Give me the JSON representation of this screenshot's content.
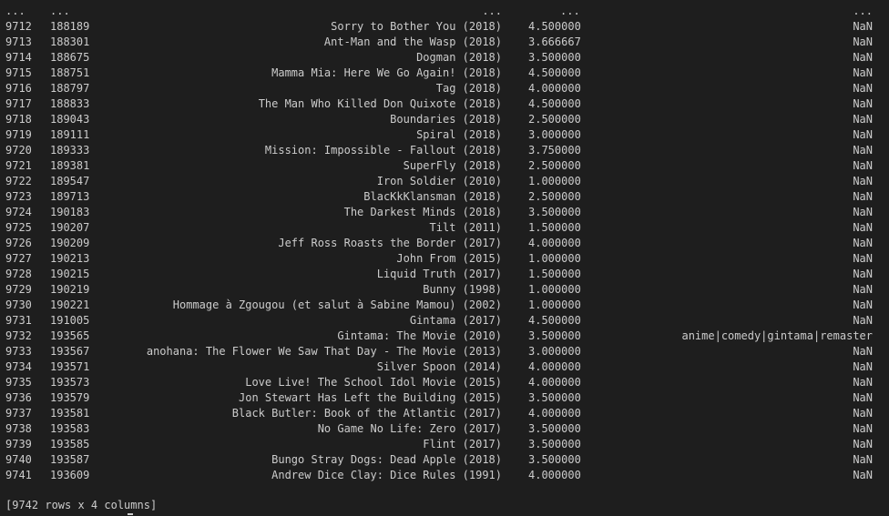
{
  "ellipsis_row": {
    "idx": "...",
    "movie_id": "...",
    "title": "...",
    "rating": "...",
    "tags": "..."
  },
  "rows": [
    {
      "idx": "9712",
      "movie_id": "188189",
      "title": "Sorry to Bother You (2018)",
      "rating": "4.500000",
      "tags": "NaN"
    },
    {
      "idx": "9713",
      "movie_id": "188301",
      "title": "Ant-Man and the Wasp (2018)",
      "rating": "3.666667",
      "tags": "NaN"
    },
    {
      "idx": "9714",
      "movie_id": "188675",
      "title": "Dogman (2018)",
      "rating": "3.500000",
      "tags": "NaN"
    },
    {
      "idx": "9715",
      "movie_id": "188751",
      "title": "Mamma Mia: Here We Go Again! (2018)",
      "rating": "4.500000",
      "tags": "NaN"
    },
    {
      "idx": "9716",
      "movie_id": "188797",
      "title": "Tag (2018)",
      "rating": "4.000000",
      "tags": "NaN"
    },
    {
      "idx": "9717",
      "movie_id": "188833",
      "title": "The Man Who Killed Don Quixote (2018)",
      "rating": "4.500000",
      "tags": "NaN"
    },
    {
      "idx": "9718",
      "movie_id": "189043",
      "title": "Boundaries (2018)",
      "rating": "2.500000",
      "tags": "NaN"
    },
    {
      "idx": "9719",
      "movie_id": "189111",
      "title": "Spiral (2018)",
      "rating": "3.000000",
      "tags": "NaN"
    },
    {
      "idx": "9720",
      "movie_id": "189333",
      "title": "Mission: Impossible - Fallout (2018)",
      "rating": "3.750000",
      "tags": "NaN"
    },
    {
      "idx": "9721",
      "movie_id": "189381",
      "title": "SuperFly (2018)",
      "rating": "2.500000",
      "tags": "NaN"
    },
    {
      "idx": "9722",
      "movie_id": "189547",
      "title": "Iron Soldier (2010)",
      "rating": "1.000000",
      "tags": "NaN"
    },
    {
      "idx": "9723",
      "movie_id": "189713",
      "title": "BlacKkKlansman (2018)",
      "rating": "2.500000",
      "tags": "NaN"
    },
    {
      "idx": "9724",
      "movie_id": "190183",
      "title": "The Darkest Minds (2018)",
      "rating": "3.500000",
      "tags": "NaN"
    },
    {
      "idx": "9725",
      "movie_id": "190207",
      "title": "Tilt (2011)",
      "rating": "1.500000",
      "tags": "NaN"
    },
    {
      "idx": "9726",
      "movie_id": "190209",
      "title": "Jeff Ross Roasts the Border (2017)",
      "rating": "4.000000",
      "tags": "NaN"
    },
    {
      "idx": "9727",
      "movie_id": "190213",
      "title": "John From (2015)",
      "rating": "1.000000",
      "tags": "NaN"
    },
    {
      "idx": "9728",
      "movie_id": "190215",
      "title": "Liquid Truth (2017)",
      "rating": "1.500000",
      "tags": "NaN"
    },
    {
      "idx": "9729",
      "movie_id": "190219",
      "title": "Bunny (1998)",
      "rating": "1.000000",
      "tags": "NaN"
    },
    {
      "idx": "9730",
      "movie_id": "190221",
      "title": "Hommage à Zgougou (et salut à Sabine Mamou) (2002)",
      "rating": "1.000000",
      "tags": "NaN"
    },
    {
      "idx": "9731",
      "movie_id": "191005",
      "title": "Gintama (2017)",
      "rating": "4.500000",
      "tags": "NaN"
    },
    {
      "idx": "9732",
      "movie_id": "193565",
      "title": "Gintama: The Movie (2010)",
      "rating": "3.500000",
      "tags": "anime|comedy|gintama|remaster"
    },
    {
      "idx": "9733",
      "movie_id": "193567",
      "title": "anohana: The Flower We Saw That Day - The Movie (2013)",
      "rating": "3.000000",
      "tags": "NaN"
    },
    {
      "idx": "9734",
      "movie_id": "193571",
      "title": "Silver Spoon (2014)",
      "rating": "4.000000",
      "tags": "NaN"
    },
    {
      "idx": "9735",
      "movie_id": "193573",
      "title": "Love Live! The School Idol Movie (2015)",
      "rating": "4.000000",
      "tags": "NaN"
    },
    {
      "idx": "9736",
      "movie_id": "193579",
      "title": "Jon Stewart Has Left the Building (2015)",
      "rating": "3.500000",
      "tags": "NaN"
    },
    {
      "idx": "9737",
      "movie_id": "193581",
      "title": "Black Butler: Book of the Atlantic (2017)",
      "rating": "4.000000",
      "tags": "NaN"
    },
    {
      "idx": "9738",
      "movie_id": "193583",
      "title": "No Game No Life: Zero (2017)",
      "rating": "3.500000",
      "tags": "NaN"
    },
    {
      "idx": "9739",
      "movie_id": "193585",
      "title": "Flint (2017)",
      "rating": "3.500000",
      "tags": "NaN"
    },
    {
      "idx": "9740",
      "movie_id": "193587",
      "title": "Bungo Stray Dogs: Dead Apple (2018)",
      "rating": "3.500000",
      "tags": "NaN"
    },
    {
      "idx": "9741",
      "movie_id": "193609",
      "title": "Andrew Dice Clay: Dice Rules (1991)",
      "rating": "4.000000",
      "tags": "NaN"
    }
  ],
  "summary": "[9742 rows x 4 columns]",
  "colors": {
    "background": "#1e1e1e",
    "text": "#cccccc"
  }
}
